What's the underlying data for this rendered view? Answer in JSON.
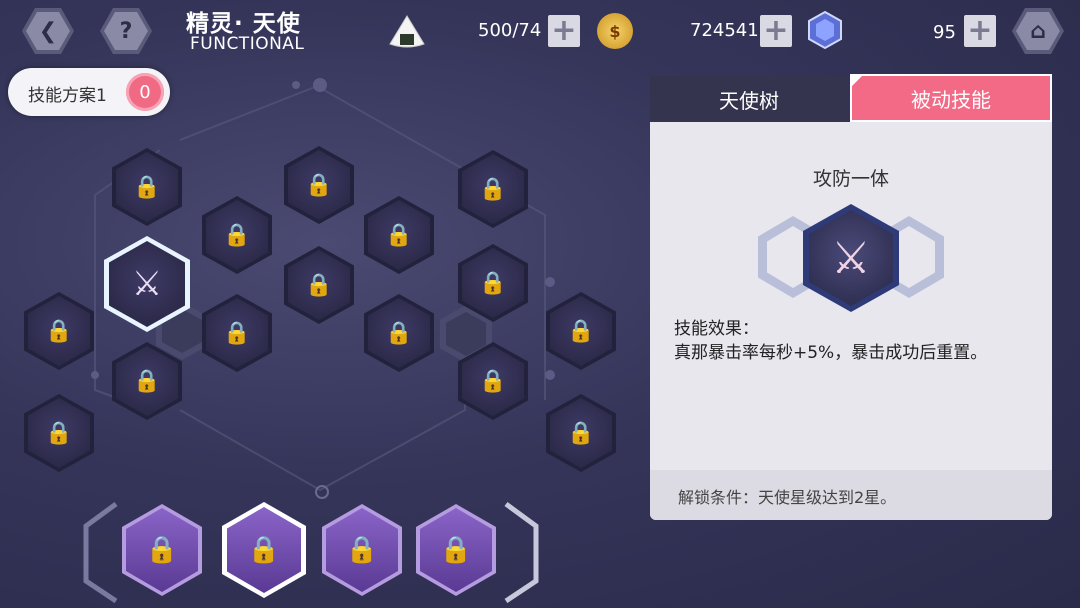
{
  "header": {
    "title_cn": "精灵· 天使",
    "title_en": "FUNCTIONAL"
  },
  "resources": {
    "stamina": "500/74",
    "coins": "724541",
    "gems": "95",
    "coin_glyph": "$"
  },
  "scheme": {
    "label": "技能方案1",
    "count": "0"
  },
  "tabs": {
    "tree": "天使树",
    "passive": "被动技能"
  },
  "detail": {
    "skill_name": "攻防一体",
    "effect_title": "技能效果：",
    "effect_text": "真那暴击率每秒+5%，暴击成功后重置。",
    "unlock_text": "解锁条件：天使星级达到2星。"
  },
  "icons": {
    "back": "back-arrow-icon",
    "help": "question-icon",
    "home": "home-icon",
    "lock": "lock-icon",
    "swords": "crossed-swords-icon"
  },
  "colors": {
    "accent": "#f26a86",
    "background": "#35355a",
    "panel": "#e8e7ee"
  }
}
